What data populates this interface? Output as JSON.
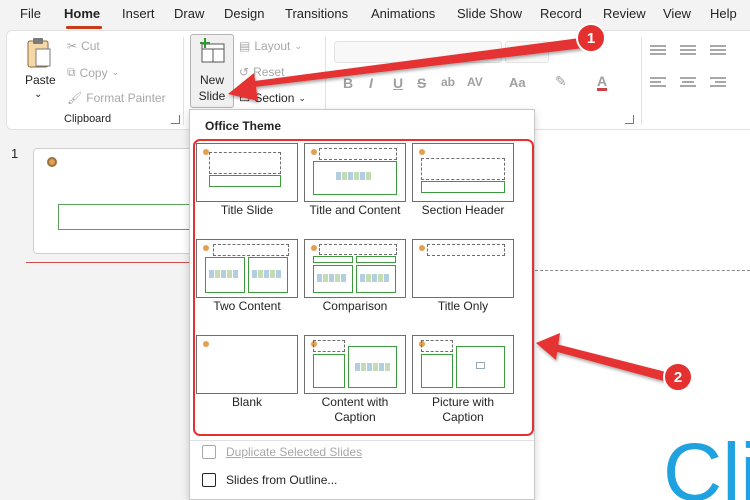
{
  "tabs": [
    "File",
    "Home",
    "Insert",
    "Draw",
    "Design",
    "Transitions",
    "Animations",
    "Slide Show",
    "Record",
    "Review",
    "View",
    "Help"
  ],
  "active_tab": "Home",
  "ribbon": {
    "paste_label": "Paste",
    "cut_label": "Cut",
    "copy_label": "Copy",
    "format_painter_label": "Format Painter",
    "clipboard_group_label": "Clipboard",
    "new_slide_line1": "New",
    "new_slide_line2": "Slide",
    "layout_label": "Layout",
    "reset_label": "Reset",
    "section_label": "Section"
  },
  "slide_pane": {
    "slide_number": "1"
  },
  "dropdown": {
    "header": "Office Theme",
    "layouts": [
      {
        "name": "Title Slide",
        "name2": ""
      },
      {
        "name": "Title and Content",
        "name2": ""
      },
      {
        "name": "Section Header",
        "name2": ""
      },
      {
        "name": "Two Content",
        "name2": ""
      },
      {
        "name": "Comparison",
        "name2": ""
      },
      {
        "name": "Title Only",
        "name2": ""
      },
      {
        "name": "Blank",
        "name2": ""
      },
      {
        "name": "Content with",
        "name2": "Caption"
      },
      {
        "name": "Picture with",
        "name2": "Caption"
      }
    ],
    "duplicate_label": "Duplicate Selected Slides",
    "outline_label": "Slides from Outline..."
  },
  "canvas": {
    "big_text": "Cli"
  },
  "annotations": {
    "badge1": "1",
    "badge2": "2"
  },
  "colors": {
    "accent_tab": "#c43e1c",
    "annotation_red": "#e53030",
    "placeholder_green": "#3d9b3d",
    "canvas_text_blue": "#21a2e0"
  }
}
